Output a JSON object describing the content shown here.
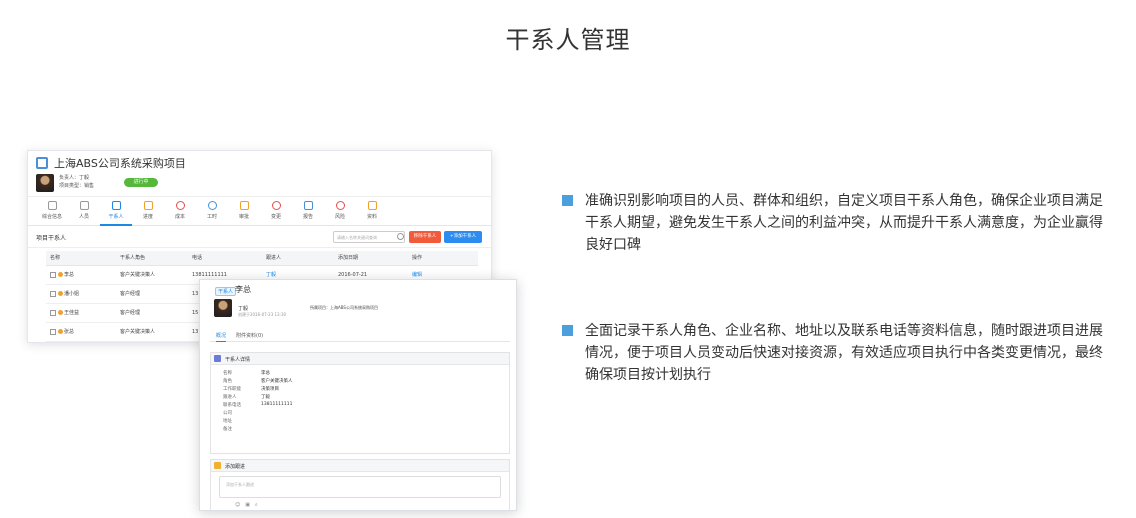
{
  "page_title": "干系人管理",
  "project_window": {
    "title": "上海ABS公司系统采购项目",
    "owner_line": "负责人：丁毅",
    "type_line": "项目类型：销售",
    "status": "进行中",
    "modules": [
      "综合信息",
      "人员",
      "干系人",
      "进度",
      "成本",
      "工时",
      "审批",
      "变更",
      "报告",
      "风险",
      "资料"
    ],
    "active_module_index": 2,
    "list_title": "项目干系人",
    "search_placeholder": "请输入名称关键词查询",
    "remove_button": "移除干系人",
    "add_button": "+添加干系人",
    "columns": [
      "名称",
      "干系人角色",
      "电话",
      "跟进人",
      "添加日期",
      "操作"
    ],
    "rows": [
      {
        "name": "李总",
        "role": "客户关键决策人",
        "phone": "13811111111",
        "follower": "丁毅",
        "date": "2016-07-21",
        "action": "编辑"
      },
      {
        "name": "潘小姐",
        "role": "客户经理",
        "phone": "13",
        "follower": "",
        "date": "",
        "action": ""
      },
      {
        "name": "王佳益",
        "role": "客户经理",
        "phone": "15",
        "follower": "",
        "date": "",
        "action": ""
      },
      {
        "name": "张总",
        "role": "客户关键决策人",
        "phone": "13",
        "follower": "",
        "date": "",
        "action": ""
      }
    ]
  },
  "detail_window": {
    "tag": "干系人",
    "name": "李总",
    "owner": "丁毅",
    "created": "创建于2016-07-23 13:30",
    "project": "所属项目：上海ABS公司系统采购项目",
    "tabs": [
      "概况",
      "附件资料(0)"
    ],
    "section_detail_title": "干系人详情",
    "fields": [
      {
        "label": "名称",
        "value": "李总"
      },
      {
        "label": "角色",
        "value": "客户关键决策人"
      },
      {
        "label": "工作职能",
        "value": "决策项目"
      },
      {
        "label": "跟进人",
        "value": "丁毅"
      },
      {
        "label": "联系电话",
        "value": "13811111111"
      },
      {
        "label": "公司",
        "value": ""
      },
      {
        "label": "地址",
        "value": ""
      },
      {
        "label": "备注",
        "value": ""
      }
    ],
    "section_follow_title": "添加跟进",
    "follow_placeholder": "添加干系人跟进"
  },
  "bullets": [
    "准确识别影响项目的人员、群体和组织，自定义项目干系人角色，确保企业项目满足干系人期望，避免发生干系人之间的利益冲突，从而提升干系人满意度，为企业赢得良好口碑",
    "全面记录干系人角色、企业名称、地址以及联系电话等资料信息，随时跟进项目进展情况，便于项目人员变动后快速对接资源，有效适应项目执行中各类变更情况，最终确保项目按计划执行"
  ],
  "colors": {
    "accent": "#1e88e5",
    "status_green": "#56b83a",
    "remove_red": "#f15a3b",
    "bullet_blue": "#4a9fdc"
  }
}
